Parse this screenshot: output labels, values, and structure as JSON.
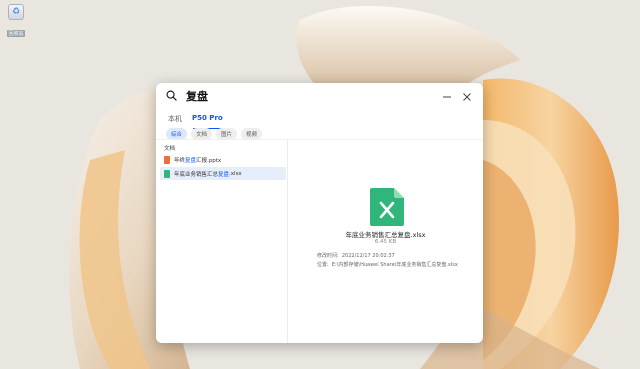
{
  "desktop": {
    "icon_name": "recycle-bin-icon",
    "icon_label": "回收站"
  },
  "search": {
    "query": "复盘"
  },
  "tabs": [
    {
      "label": "本机",
      "active": false
    },
    {
      "label": "P50 Pro",
      "active": true
    }
  ],
  "filters": [
    {
      "label": "综合",
      "active": true
    },
    {
      "label": "文档",
      "active": false
    },
    {
      "label": "图片",
      "active": false
    },
    {
      "label": "视频",
      "active": false
    }
  ],
  "results": {
    "section_label": "文档",
    "items": [
      {
        "icon": "pptx-file-icon",
        "pre": "年终",
        "match": "复盘",
        "post": "汇报.pptx",
        "selected": false
      },
      {
        "icon": "xlsx-file-icon",
        "pre": "年底业务销售汇总",
        "match": "复盘",
        "post": ".xlsx",
        "selected": true
      }
    ]
  },
  "preview": {
    "icon": "xlsx-file-icon",
    "file_name": "年底业务销售汇总复盘.xlsx",
    "file_size": "6.45 KB",
    "modified_label": "修改时间:",
    "modified_value": "2022/12/17 20:02:37",
    "location_label": "位置:",
    "location_value": "E:\\内部存储\\Huawei Share\\年底业务销售汇总复盘.xlsx"
  },
  "colors": {
    "accent": "#0a59f7",
    "excel_green": "#2fb67a",
    "ppt_orange": "#ed6d3d"
  }
}
